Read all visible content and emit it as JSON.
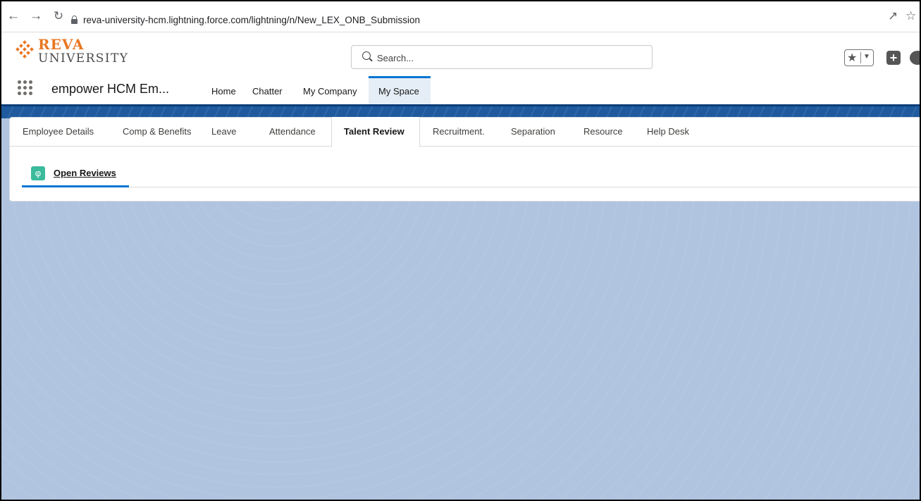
{
  "browser": {
    "back_icon": "arrow-left-icon",
    "forward_icon": "arrow-right-icon",
    "reload_icon": "reload-icon",
    "url": "reva-university-hcm.lightning.force.com/lightning/n/New_LEX_ONB_Submission"
  },
  "header": {
    "logo_line1": "REVA",
    "logo_line2": "UNIVERSITY",
    "search_placeholder": "Search..."
  },
  "app": {
    "name": "empower HCM Em...",
    "nav": [
      "Home",
      "Chatter",
      "My Company",
      "My Space"
    ],
    "active_nav": "My Space"
  },
  "tabs": {
    "items": [
      "Employee Details",
      "Comp & Benefits",
      "Leave",
      "Attendance",
      "Talent Review",
      "Recruitment.",
      "Separation",
      "Resource",
      "Help Desk"
    ],
    "active": "Talent Review"
  },
  "subtab": {
    "label": "Open Reviews",
    "icon": "lightbulb-icon"
  },
  "colors": {
    "accent": "#0176d3",
    "logo_orange": "#e87722",
    "banner_blue": "#1f5a9e",
    "page_bg": "#b0c4df",
    "subtab_icon_green": "#3bba9c"
  }
}
